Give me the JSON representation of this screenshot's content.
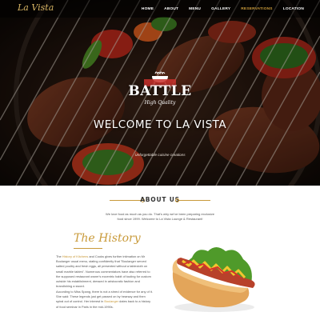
{
  "header": {
    "logo": "La Vista",
    "nav": [
      {
        "label": "HOME",
        "active": false
      },
      {
        "label": "ABOUT",
        "active": false
      },
      {
        "label": "MENU",
        "active": false
      },
      {
        "label": "GALLERY",
        "active": false
      },
      {
        "label": "RESERVATIONS",
        "active": true
      },
      {
        "label": "LOCATION",
        "active": false
      }
    ]
  },
  "hero": {
    "emblem_title": "BATTLE",
    "emblem_subtitle": "High Quality",
    "welcome": "WELCOME TO LA VISTA",
    "subtitle": "Unforgettable cuisine creations"
  },
  "about": {
    "title": "ABOUT US",
    "text": "We love food as much as you do. That's why we've been preparing exclusive food since 1999. Welcome to La Vista Lounge & Restaurant!"
  },
  "history": {
    "title": "The History",
    "p1": {
      "before": "The ",
      "highlight": "History of Kitchens",
      "after": " and Cooks gives further intimation on Mr Boulanger usual menu, stating confidently that \"Boulanger served salted poultry and fresh eggs, all presented without a tablecloth on small marble tables\". Numerous commentators have also referred to the supposed restaurant owner's eccentric habit of touting for custom outside his establishment, dressed in aristocratic fashion and brandishing a sword."
    },
    "p2": {
      "before": "According to Miss Spang, there is not a shred of evidence for any of it. She said: These legends just get passed on by hearsay and then spiral out of control. Her interest in ",
      "highlight": "Boulanger",
      "after": " dates back to a history of food seminar in Paris in the mid-1990s."
    }
  },
  "colors": {
    "accent": "#c99a3a",
    "nav_text": "#ffffff",
    "body_text": "#555555"
  },
  "icons": [
    "bbq-grill-icon"
  ]
}
